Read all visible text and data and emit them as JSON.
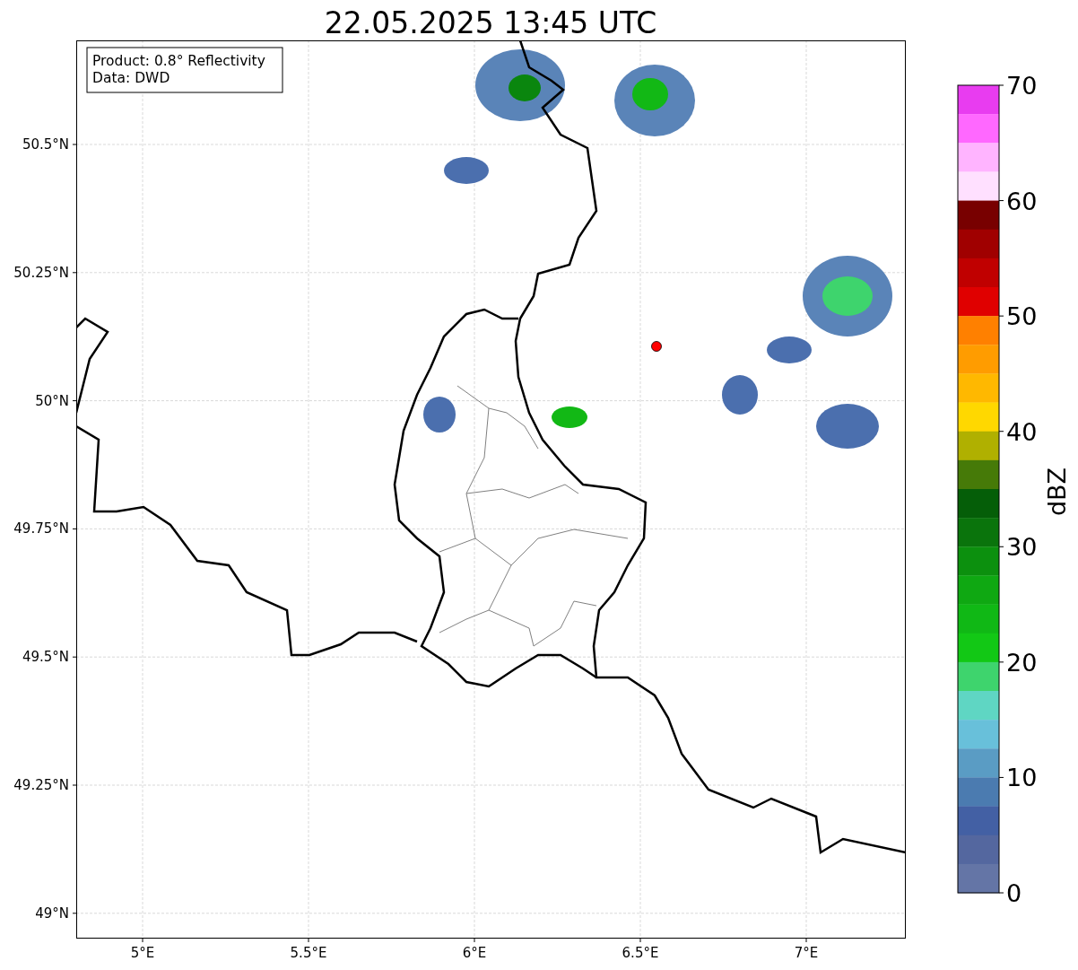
{
  "title": "22.05.2025 13:45 UTC",
  "info_box": [
    "Product: 0.8° Reflectivity",
    "Data: DWD"
  ],
  "y_ticks": [
    "50.5°N",
    "50.25°N",
    "50°N",
    "49.75°N",
    "49.5°N",
    "49.25°N",
    "49°N"
  ],
  "x_ticks": [
    "5°E",
    "5.5°E",
    "6°E",
    "6.5°E",
    "7°E"
  ],
  "colorbar": {
    "label": "dBZ",
    "ticks": [
      "70",
      "60",
      "50",
      "40",
      "30",
      "20",
      "10",
      "0"
    ],
    "segments": [
      {
        "color": "#e83cf0"
      },
      {
        "color": "#ff68ff"
      },
      {
        "color": "#ffb4ff"
      },
      {
        "color": "#ffe0ff"
      },
      {
        "color": "#780000"
      },
      {
        "color": "#a00000"
      },
      {
        "color": "#c00000"
      },
      {
        "color": "#e00000"
      },
      {
        "color": "#ff8000"
      },
      {
        "color": "#ff9c00"
      },
      {
        "color": "#ffb800"
      },
      {
        "color": "#ffd800"
      },
      {
        "color": "#b0b000"
      },
      {
        "color": "#467a08"
      },
      {
        "color": "#055e08"
      },
      {
        "color": "#0a740c"
      },
      {
        "color": "#0c900e"
      },
      {
        "color": "#0fa812"
      },
      {
        "color": "#10b815"
      },
      {
        "color": "#12c815"
      },
      {
        "color": "#3ed46d"
      },
      {
        "color": "#5fd6c3"
      },
      {
        "color": "#68c0da"
      },
      {
        "color": "#5a9cc4"
      },
      {
        "color": "#4b7bb0"
      },
      {
        "color": "#4360a4"
      },
      {
        "color": "#54679f"
      },
      {
        "color": "#6475a6"
      }
    ]
  }
}
